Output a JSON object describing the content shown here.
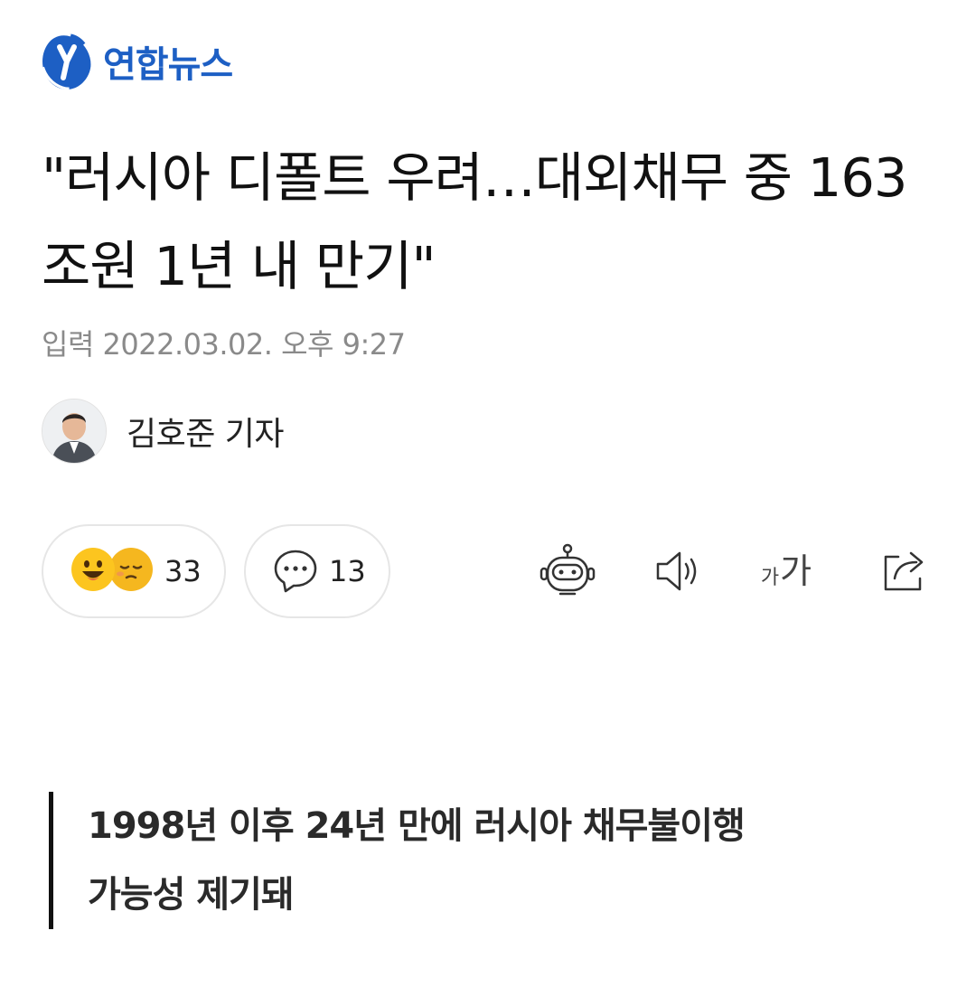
{
  "brand": {
    "logo_name": "연합뉴스",
    "accent_color": "#1d5fc4"
  },
  "article": {
    "headline": "\"러시아 디폴트 우려…대외채무 중 163조원 1년 내 만기\"",
    "date": "입력 2022.03.02. 오후 9:27",
    "reporter": "김호준 기자",
    "subtitle_line_1": "1998년 이후 24년 만에 러시아 채무불이행",
    "subtitle_line_2": "가능성 제기돼"
  },
  "actions": {
    "reactions_count": "33",
    "comments_count": "13",
    "font_size_small": "가",
    "font_size_big": "가",
    "icons": [
      "smiley-icon",
      "sleepy-face-icon",
      "comment-icon",
      "robot-summary-icon",
      "speaker-icon",
      "font-size-icon",
      "share-icon"
    ]
  }
}
